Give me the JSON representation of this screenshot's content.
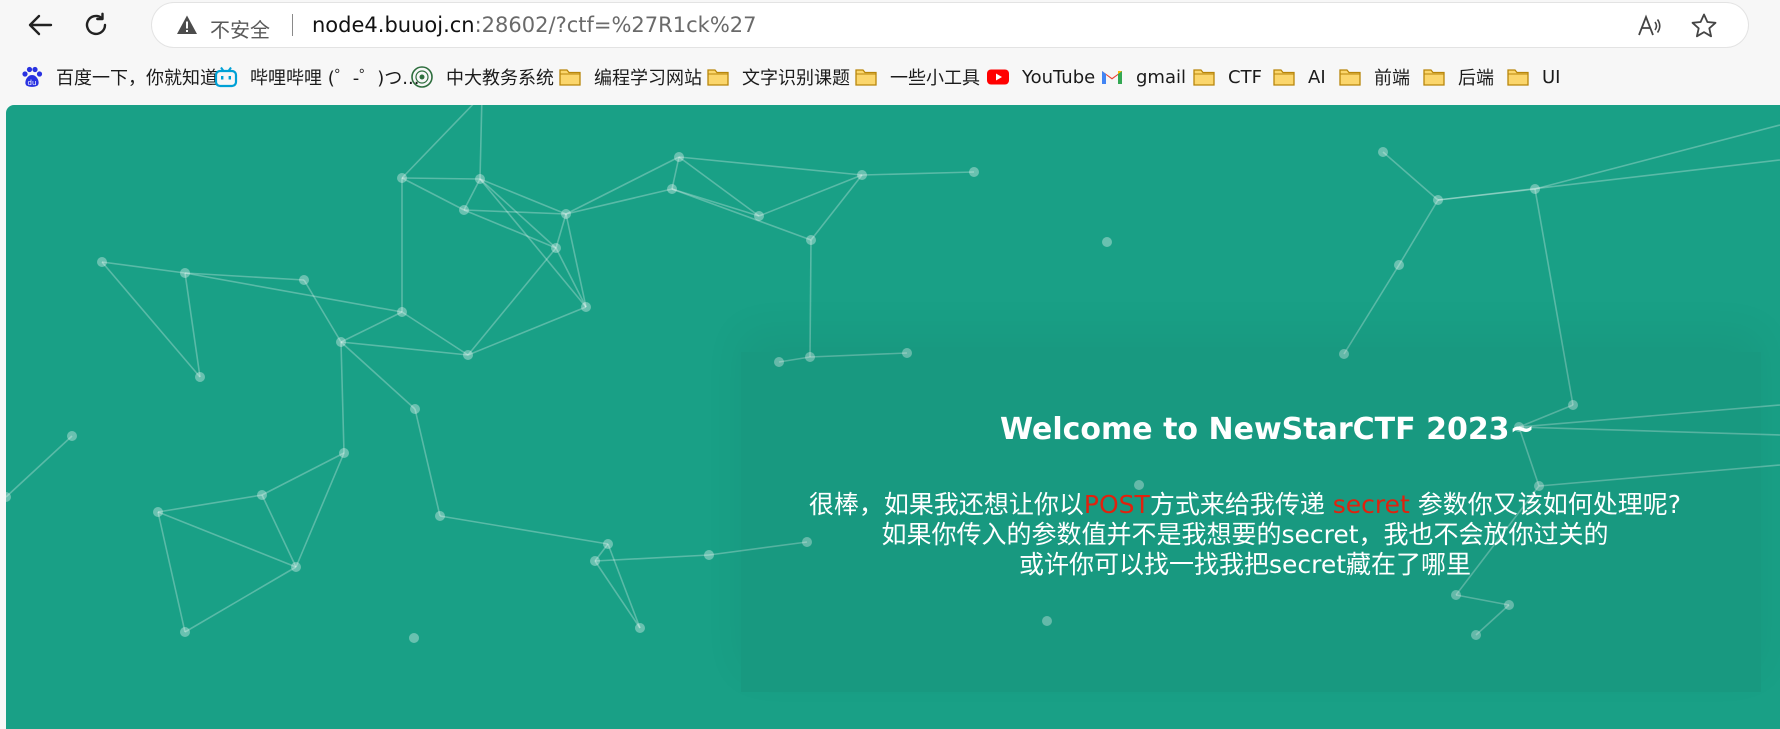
{
  "browser": {
    "security_label": "不安全",
    "url_host": "node4.buuoj.cn",
    "url_rest": ":28602/?ctf=%27R1ck%27",
    "bookmarks": [
      {
        "label": "百度一下，你就知道",
        "icon": "baidu-icon"
      },
      {
        "label": "哔哩哔哩 (゜-゜)つ...",
        "icon": "bilibili-icon"
      },
      {
        "label": "中大教务系统",
        "icon": "sysu-icon"
      },
      {
        "label": "编程学习网站",
        "icon": "folder-icon"
      },
      {
        "label": "文字识别课题",
        "icon": "folder-icon"
      },
      {
        "label": "一些小工具",
        "icon": "folder-icon"
      },
      {
        "label": "YouTube",
        "icon": "youtube-icon"
      },
      {
        "label": "gmail",
        "icon": "gmail-icon"
      },
      {
        "label": "CTF",
        "icon": "folder-icon"
      },
      {
        "label": "AI",
        "icon": "folder-icon"
      },
      {
        "label": "前端",
        "icon": "folder-icon"
      },
      {
        "label": "后端",
        "icon": "folder-icon"
      },
      {
        "label": "UI",
        "icon": "folder-icon"
      }
    ]
  },
  "page": {
    "title": "Welcome to NewStarCTF 2023~",
    "line1_a": "很棒，如果我还想让你以",
    "line1_post": "POST",
    "line1_b": "方式来给我传递 ",
    "line1_secret": "secret",
    "line1_c": " 参数你又该如何处理呢?",
    "line2": "如果你传入的参数值并不是我想要的secret，我也不会放你过关的",
    "line3": "或许你可以找一找我把secret藏在了哪里",
    "colors": {
      "background": "#19a086",
      "highlight": "#e0220e"
    }
  }
}
